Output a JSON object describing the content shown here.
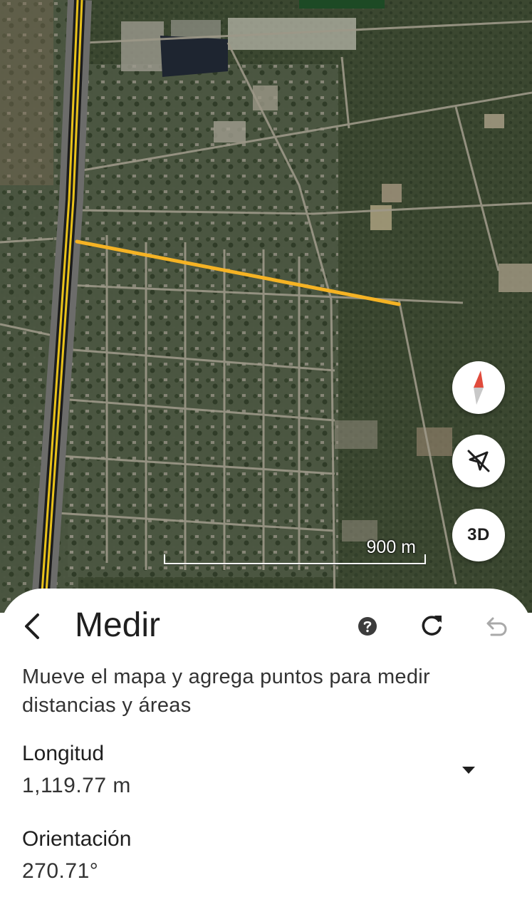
{
  "map": {
    "scale_label": "900 m",
    "view_3d_label": "3D"
  },
  "measure_panel": {
    "title": "Medir",
    "description": "Mueve el mapa y agrega puntos para medir distancias y áreas",
    "length": {
      "label": "Longitud",
      "value": "1,119.77 m"
    },
    "orientation": {
      "label": "Orientación",
      "value": "270.71°"
    }
  },
  "colors": {
    "measure_line": "#f5b324",
    "road": "#e8c21a",
    "text_primary": "#1f1f1f"
  },
  "icons": {
    "back": "chevron-left-icon",
    "help": "help-circle-icon",
    "reset": "refresh-icon",
    "undo": "undo-icon",
    "compass": "compass-icon",
    "location": "location-off-icon",
    "dropdown": "caret-down-icon"
  }
}
